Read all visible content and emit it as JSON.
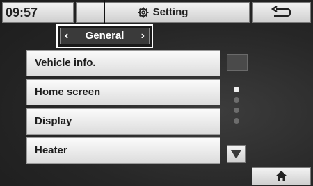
{
  "status_bar": {
    "time": "09:57",
    "title": "Setting"
  },
  "tab": {
    "label": "General"
  },
  "menu": [
    {
      "label": "Vehicle info."
    },
    {
      "label": "Home screen"
    },
    {
      "label": "Display"
    },
    {
      "label": "Heater"
    }
  ],
  "page_indicator": {
    "count": 4,
    "active_index": 0
  },
  "icons": {
    "title": "gear-icon",
    "back": "back-arrow-icon",
    "prev": "chevron-left-icon",
    "next": "chevron-right-icon",
    "scroll": "down-triangle-icon",
    "home": "home-icon"
  }
}
